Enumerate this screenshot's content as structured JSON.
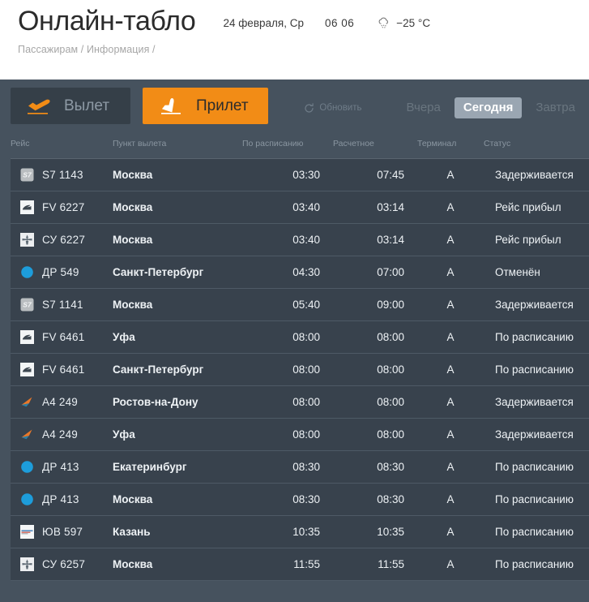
{
  "header": {
    "title": "Онлайн-табло",
    "date": "24 февраля, Ср",
    "time": "06  06",
    "weather_icon": "cloud-snow-icon",
    "temperature": "−25 °C",
    "breadcrumb": "Пассажирам / Информация /"
  },
  "controls": {
    "tab_departure": "Вылет",
    "tab_departure_icon": "plane-departure-icon",
    "tab_arrival": "Прилет",
    "tab_arrival_icon": "plane-arrival-icon",
    "refresh_label": "Обновить",
    "refresh_icon": "refresh-icon",
    "days": [
      {
        "label": "Вчера",
        "active": false
      },
      {
        "label": "Сегодня",
        "active": true
      },
      {
        "label": "Завтра",
        "active": false
      }
    ]
  },
  "table": {
    "columns": {
      "flight": "Рейс",
      "origin": "Пункт вылета",
      "scheduled": "По расписанию",
      "estimated": "Расчетное",
      "terminal": "Терминал",
      "status": "Статус"
    },
    "rows": [
      {
        "logo": "s7-logo-icon",
        "flight": "S7 1143",
        "origin": "Москва",
        "scheduled": "03:30",
        "estimated": "07:45",
        "terminal": "A",
        "status": "Задерживается",
        "status_kind": "delayed"
      },
      {
        "logo": "rossiya-logo-icon",
        "flight": "FV 6227",
        "origin": "Москва",
        "scheduled": "03:40",
        "estimated": "03:14",
        "terminal": "A",
        "status": "Рейс прибыл",
        "status_kind": "arrived"
      },
      {
        "logo": "aeroflot-logo-icon",
        "flight": "СУ 6227",
        "origin": "Москва",
        "scheduled": "03:40",
        "estimated": "03:14",
        "terminal": "A",
        "status": "Рейс прибыл",
        "status_kind": "arrived"
      },
      {
        "logo": "blue-dot-logo-icon",
        "flight": "ДР 549",
        "origin": "Санкт-Петербург",
        "scheduled": "04:30",
        "estimated": "07:00",
        "terminal": "A",
        "status": "Отменён",
        "status_kind": "cancel"
      },
      {
        "logo": "s7-logo-icon",
        "flight": "S7 1141",
        "origin": "Москва",
        "scheduled": "05:40",
        "estimated": "09:00",
        "terminal": "A",
        "status": "Задерживается",
        "status_kind": "delayed"
      },
      {
        "logo": "rossiya-logo-icon",
        "flight": "FV 6461",
        "origin": "Уфа",
        "scheduled": "08:00",
        "estimated": "08:00",
        "terminal": "A",
        "status": "По расписанию",
        "status_kind": "ontime"
      },
      {
        "logo": "rossiya-logo-icon",
        "flight": "FV 6461",
        "origin": "Санкт-Петербург",
        "scheduled": "08:00",
        "estimated": "08:00",
        "terminal": "A",
        "status": "По расписанию",
        "status_kind": "ontime"
      },
      {
        "logo": "azimuth-logo-icon",
        "flight": "A4 249",
        "origin": "Ростов-на-Дону",
        "scheduled": "08:00",
        "estimated": "08:00",
        "terminal": "A",
        "status": "Задерживается",
        "status_kind": "delayed"
      },
      {
        "logo": "azimuth-logo-icon",
        "flight": "A4 249",
        "origin": "Уфа",
        "scheduled": "08:00",
        "estimated": "08:00",
        "terminal": "A",
        "status": "Задерживается",
        "status_kind": "delayed"
      },
      {
        "logo": "blue-dot-logo-icon",
        "flight": "ДР 413",
        "origin": "Екатеринбург",
        "scheduled": "08:30",
        "estimated": "08:30",
        "terminal": "A",
        "status": "По расписанию",
        "status_kind": "ontime"
      },
      {
        "logo": "blue-dot-logo-icon",
        "flight": "ДР 413",
        "origin": "Москва",
        "scheduled": "08:30",
        "estimated": "08:30",
        "terminal": "A",
        "status": "По расписанию",
        "status_kind": "ontime"
      },
      {
        "logo": "yuv-logo-icon",
        "flight": "ЮВ 597",
        "origin": "Казань",
        "scheduled": "10:35",
        "estimated": "10:35",
        "terminal": "A",
        "status": "По расписанию",
        "status_kind": "ontime"
      },
      {
        "logo": "aeroflot-logo-icon",
        "flight": "СУ 6257",
        "origin": "Москва",
        "scheduled": "11:55",
        "estimated": "11:55",
        "terminal": "A",
        "status": "По расписанию",
        "status_kind": "ontime"
      }
    ]
  },
  "colors": {
    "panel_bg": "#46525e",
    "row_bg": "#38424d",
    "accent_orange": "#f28c16",
    "delayed": "#bfa64a",
    "cancelled": "#d76a5a",
    "active_day_bg": "#9aa6b2"
  }
}
